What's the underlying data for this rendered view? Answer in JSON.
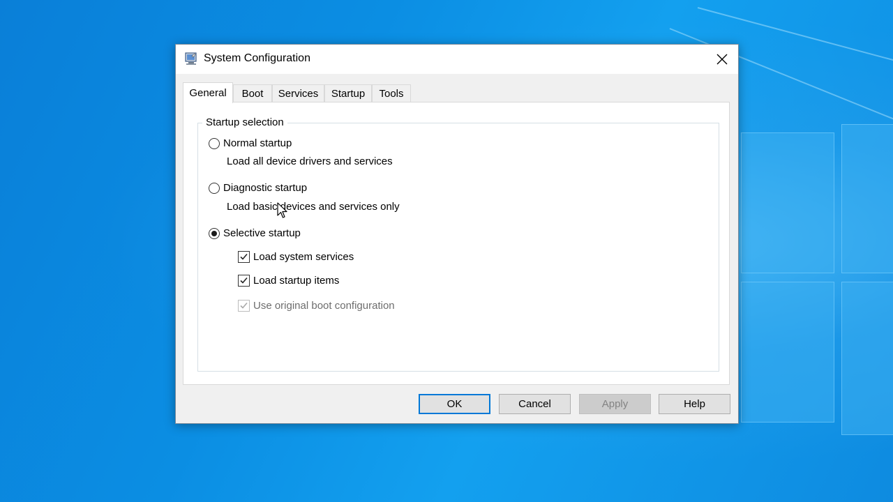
{
  "window": {
    "title": "System Configuration",
    "icon": "msconfig-icon",
    "close_icon": "close-icon"
  },
  "tabs": [
    {
      "label": "General",
      "active": true
    },
    {
      "label": "Boot",
      "active": false
    },
    {
      "label": "Services",
      "active": false
    },
    {
      "label": "Startup",
      "active": false
    },
    {
      "label": "Tools",
      "active": false
    }
  ],
  "general": {
    "group_label": "Startup selection",
    "normal": {
      "label": "Normal startup",
      "description": "Load all device drivers and services",
      "checked": false
    },
    "diagnostic": {
      "label": "Diagnostic startup",
      "description": "Load basic devices and services only",
      "checked": false
    },
    "selective": {
      "label": "Selective startup",
      "checked": true,
      "options": [
        {
          "label": "Load system services",
          "checked": true,
          "enabled": true
        },
        {
          "label": "Load startup items",
          "checked": true,
          "enabled": true
        },
        {
          "label": "Use original boot configuration",
          "checked": true,
          "enabled": false
        }
      ]
    }
  },
  "buttons": {
    "ok": "OK",
    "cancel": "Cancel",
    "apply": "Apply",
    "help": "Help"
  },
  "colors": {
    "accent": "#0078d7",
    "desktop": "#0b8ee3"
  }
}
